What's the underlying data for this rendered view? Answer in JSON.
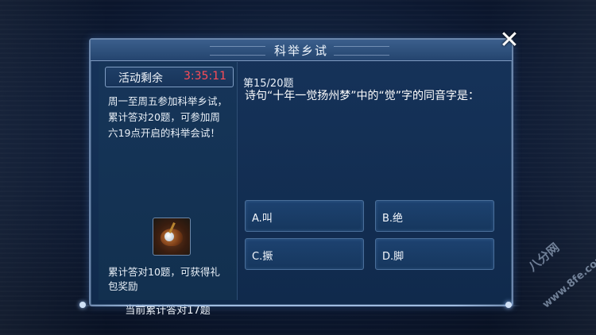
{
  "dialog": {
    "title": "科举乡试",
    "close_symbol": "✕"
  },
  "sidebar": {
    "timer_label": "活动剩余",
    "timer_value": "3:35:11",
    "description": "周一至周五参加科举乡试，累计答对20题，可参加周六19点开启的科举会试！",
    "reward_text": "累计答对10题，可获得礼包奖励",
    "progress_text": "当前累计答对17题"
  },
  "question": {
    "number": "第15/20题",
    "text": "诗句“十年一觉扬州梦”中的“觉”字的同音字是：",
    "options": [
      {
        "label": "A.叫"
      },
      {
        "label": "B.绝"
      },
      {
        "label": "C.撅"
      },
      {
        "label": "D.脚"
      }
    ]
  },
  "watermark": {
    "line1": "八分网",
    "line2": "www.8fe.com"
  },
  "colors": {
    "timer": "#ff4d57",
    "panel": "#16335a",
    "border": "#6b86ab"
  }
}
